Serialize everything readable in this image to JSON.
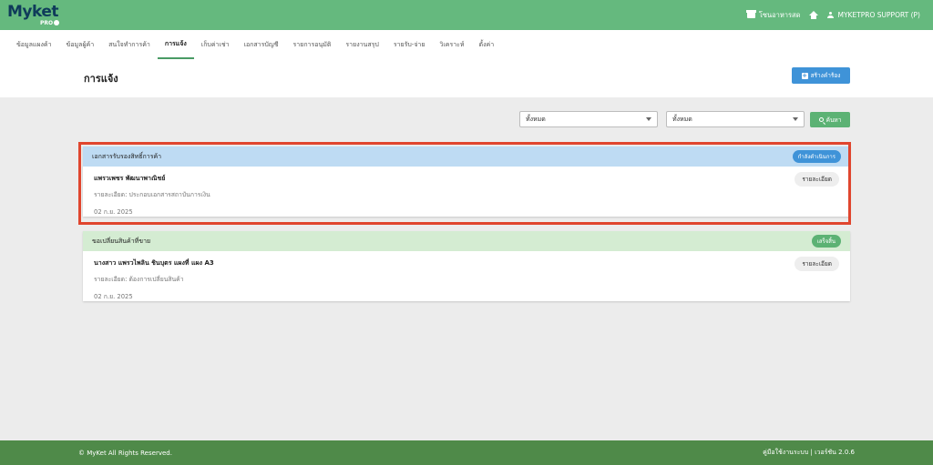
{
  "brand": {
    "name": "Myket",
    "sub": "PRO"
  },
  "topbar": {
    "shop": "โซนอาหารสด",
    "user": "MYKETPRO SUPPORT (P)"
  },
  "nav": [
    "ข้อมูลแผงค้า",
    "ข้อมูลผู้ค้า",
    "สนใจทำการค้า",
    "การแจ้ง",
    "เก็บค่าเช่า",
    "เอกสารบัญชี",
    "รายการอนุมัติ",
    "รายงานสรุป",
    "รายรับ-จ่าย",
    "วิเคราะห์",
    "ตั้งค่า"
  ],
  "nav_active_index": 3,
  "page": {
    "title": "การแจ้ง",
    "create_label": "สร้างคำร้อง"
  },
  "filters": {
    "filter1": "ทั้งหมด",
    "filter2": "ทั้งหมด",
    "search_label": "ค้นหา"
  },
  "requests": [
    {
      "title": "เอกสารรับรองสิทธิ์การค้า",
      "status": "กำลังดำเนินการ",
      "status_color": "#3f93d8",
      "head_color": "#bedbf3",
      "name": "แพรวเพชร พัฒนาพาณิชย์",
      "detail": "รายละเอียด: ประกอบเอกสารสถาบันการเงิน",
      "date": "02 ก.ย. 2025",
      "detail_btn": "รายละเอียด"
    },
    {
      "title": "ขอเปลี่ยนสินค้าที่ขาย",
      "status": "เสร็จสิ้น",
      "status_color": "#5cb274",
      "head_color": "#d4ecd2",
      "name": "นางสาว แพรวไพลิน ชินบุตร แผงที่ แผง A3",
      "detail": "รายละเอียด: ต้องการเปลี่ยนสินค้า",
      "date": "02 ก.ย. 2025",
      "detail_btn": "รายละเอียด"
    }
  ],
  "footer": {
    "copyright": "© MyKet All Rights Reserved.",
    "version": "คู่มือใช้งานระบบ | เวอร์ชัน 2.0.6"
  }
}
